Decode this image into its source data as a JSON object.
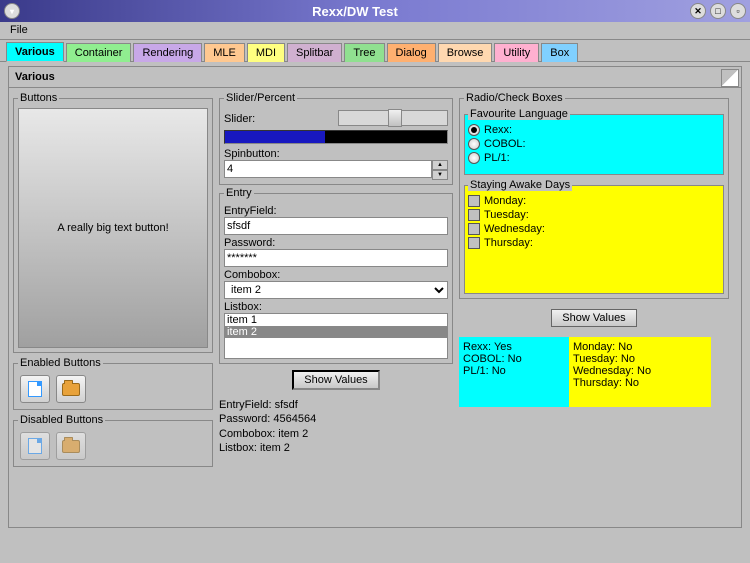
{
  "window": {
    "title": "Rexx/DW Test"
  },
  "menu": {
    "file": "File"
  },
  "tabs": [
    {
      "label": "Various",
      "color": "#00ffff",
      "active": true
    },
    {
      "label": "Container",
      "color": "#90ee90"
    },
    {
      "label": "Rendering",
      "color": "#c8a8e8"
    },
    {
      "label": "MLE",
      "color": "#ffc890"
    },
    {
      "label": "MDI",
      "color": "#ffff80"
    },
    {
      "label": "Splitbar",
      "color": "#d0b0d0"
    },
    {
      "label": "Tree",
      "color": "#90e090"
    },
    {
      "label": "Dialog",
      "color": "#ffb070"
    },
    {
      "label": "Browse",
      "color": "#ffd8b0"
    },
    {
      "label": "Utility",
      "color": "#ffb0d0"
    },
    {
      "label": "Box",
      "color": "#80d0ff"
    }
  ],
  "page_title": "Various",
  "groups": {
    "buttons": "Buttons",
    "enabled": "Enabled Buttons",
    "disabled": "Disabled Buttons",
    "slider": "Slider/Percent",
    "entry": "Entry",
    "radio": "Radio/Check Boxes",
    "fav": "Favourite Language",
    "stay": "Staying Awake Days"
  },
  "buttons": {
    "big": "A really big text button!",
    "show_values": "Show Values"
  },
  "slider": {
    "slider_lbl": "Slider:",
    "spin_lbl": "Spinbutton:",
    "spin_val": "4",
    "percent": 45
  },
  "entry": {
    "ef_lbl": "EntryField:",
    "ef_val": "sfsdf",
    "pw_lbl": "Password:",
    "pw_val": "*******",
    "cb_lbl": "Combobox:",
    "cb_val": "item 2",
    "lb_lbl": "Listbox:",
    "lb_items": [
      "item 1",
      "item 2"
    ],
    "lb_selected": 1
  },
  "entry_results": {
    "l1": "EntryField: sfsdf",
    "l2": "Password: 4564564",
    "l3": "Combobox: item 2",
    "l4": "Listbox: item 2"
  },
  "fav": {
    "items": [
      {
        "label": "Rexx:",
        "sel": true
      },
      {
        "label": "COBOL:",
        "sel": false
      },
      {
        "label": "PL/1:",
        "sel": false
      }
    ]
  },
  "stay": {
    "items": [
      {
        "label": "Monday:"
      },
      {
        "label": "Tuesday:"
      },
      {
        "label": "Wednesday:"
      },
      {
        "label": "Thursday:"
      }
    ]
  },
  "results_a": {
    "l1": "Rexx: Yes",
    "l2": "COBOL: No",
    "l3": "PL/1: No"
  },
  "results_b": {
    "l1": "Monday: No",
    "l2": "Tuesday: No",
    "l3": "Wednesday: No",
    "l4": "Thursday: No"
  }
}
